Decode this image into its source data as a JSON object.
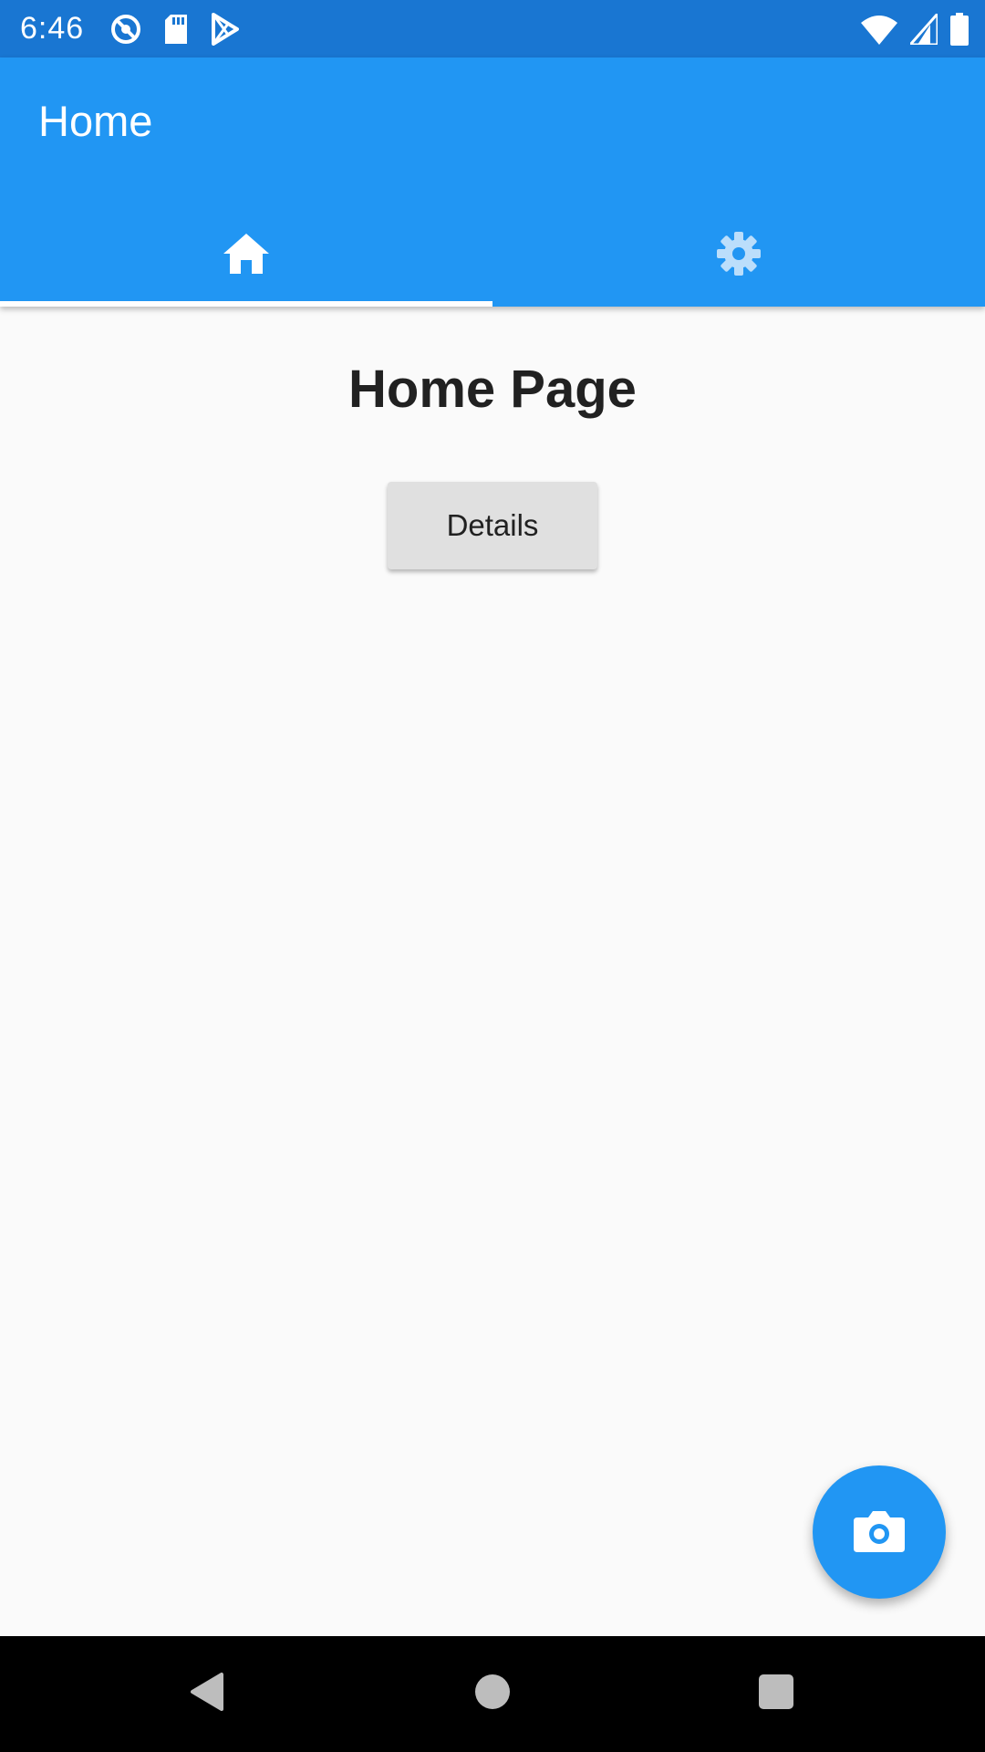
{
  "status_bar": {
    "time": "6:46",
    "background": "#1976d2",
    "left_icons": [
      "do-not-disturb-icon",
      "sd-card-icon",
      "play-store-icon"
    ],
    "right_icons": [
      "wifi-icon",
      "cell-signal-icon",
      "battery-icon"
    ]
  },
  "app_bar": {
    "title": "Home",
    "background": "#2196f3",
    "tabs": [
      {
        "icon": "home-icon",
        "selected": true
      },
      {
        "icon": "gear-icon",
        "selected": false
      }
    ]
  },
  "main": {
    "page_title": "Home Page",
    "details_button_label": "Details"
  },
  "fab": {
    "icon": "camera-icon",
    "color": "#2196f3"
  },
  "nav_bar": {
    "buttons": [
      "back-icon",
      "home-circle-icon",
      "recents-icon"
    ]
  }
}
